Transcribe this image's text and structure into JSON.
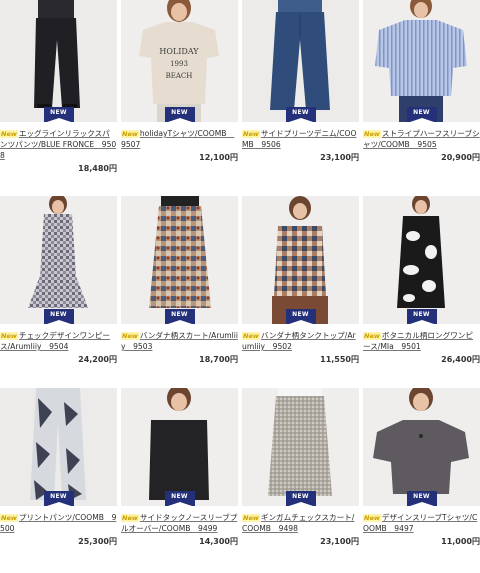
{
  "new_badge": "NEW",
  "new_mark": "New",
  "products": [
    {
      "name": "エッグラインリラックスパンツパンツ/BLUE FRONCE　9508",
      "price": "18,480円",
      "image": "navy-wide-pants"
    },
    {
      "name": "holidayTシャツ/COOMB　9507",
      "price": "12,100円",
      "image": "beige-print-tshirt"
    },
    {
      "name": "サイドプリーツデニム/COOMB　9506",
      "price": "23,100円",
      "image": "denim-wide-pants"
    },
    {
      "name": "ストライプハーフスリーブシャツ/COOMB　9505",
      "price": "20,900円",
      "image": "blue-stripe-shirt"
    },
    {
      "name": "チェックデザインワンピース/Arumliiy　9504",
      "price": "24,200円",
      "image": "check-dress"
    },
    {
      "name": "バンダナ柄スカート/Arumliiy　9503",
      "price": "18,700円",
      "image": "bandana-skirt"
    },
    {
      "name": "バンダナ柄タンクトップ/Arumliiy　9502",
      "price": "11,550円",
      "image": "bandana-tank"
    },
    {
      "name": "ボタニカル柄ロングワンピース/MIa　9501",
      "price": "26,400円",
      "image": "botanical-dress"
    },
    {
      "name": "プリントパンツ/COOMB　9500",
      "price": "25,300円",
      "image": "print-pants"
    },
    {
      "name": "サイドタックノースリーブプルオーバー/COOMB　9499",
      "price": "14,300円",
      "image": "black-sleeveless"
    },
    {
      "name": "ギンガムチェックスカート/COOMB　9498",
      "price": "23,100円",
      "image": "gingham-skirt"
    },
    {
      "name": "デザインスリーブTシャツ/COOMB　9497",
      "price": "11,000円",
      "image": "grey-tshirt"
    }
  ]
}
